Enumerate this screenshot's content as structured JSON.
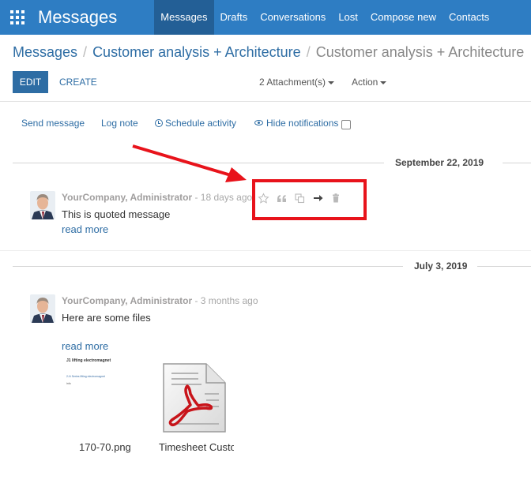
{
  "app": {
    "title": "Messages"
  },
  "nav": {
    "items": [
      {
        "label": "Messages",
        "active": true
      },
      {
        "label": "Drafts",
        "active": false
      },
      {
        "label": "Conversations",
        "active": false
      },
      {
        "label": "Lost",
        "active": false
      },
      {
        "label": "Compose new",
        "active": false
      },
      {
        "label": "Contacts",
        "active": false
      }
    ]
  },
  "breadcrumb": {
    "items": [
      "Messages",
      "Customer analysis + Architecture"
    ],
    "current": "Customer analysis + Architecture"
  },
  "control_panel": {
    "edit_label": "EDIT",
    "create_label": "CREATE",
    "attachments_label": "2 Attachment(s)",
    "action_label": "Action"
  },
  "chatter": {
    "send_message": "Send message",
    "log_note": "Log note",
    "schedule_activity": "Schedule activity",
    "hide_notifications": "Hide notifications"
  },
  "threads": [
    {
      "date": "September 22, 2019",
      "messages": [
        {
          "author": "YourCompany, Administrator",
          "time_ago": "- 18 days ago",
          "body": "This is quoted message",
          "read_more": "read more"
        }
      ]
    },
    {
      "date": "July 3, 2019",
      "messages": [
        {
          "author": "YourCompany, Administrator",
          "time_ago": "- 3 months ago",
          "body": "Here are some files",
          "read_more": "read more",
          "attachments": [
            {
              "name": "170-70.png",
              "thumb_title": "J1 lifting electromagnet",
              "thumb_line": "2-N Series lifting electromagnet",
              "thumb_small": "info"
            },
            {
              "name": "Timesheet Customer"
            }
          ]
        }
      ]
    }
  ],
  "message_actions": [
    "star-icon",
    "quote-icon",
    "copy-icon",
    "forward-arrow-icon",
    "trash-icon"
  ],
  "colors": {
    "navbar": "#2e7dc3",
    "navbar_active": "#235f96",
    "primary": "#2e6da4",
    "annotation_red": "#e8131b"
  }
}
